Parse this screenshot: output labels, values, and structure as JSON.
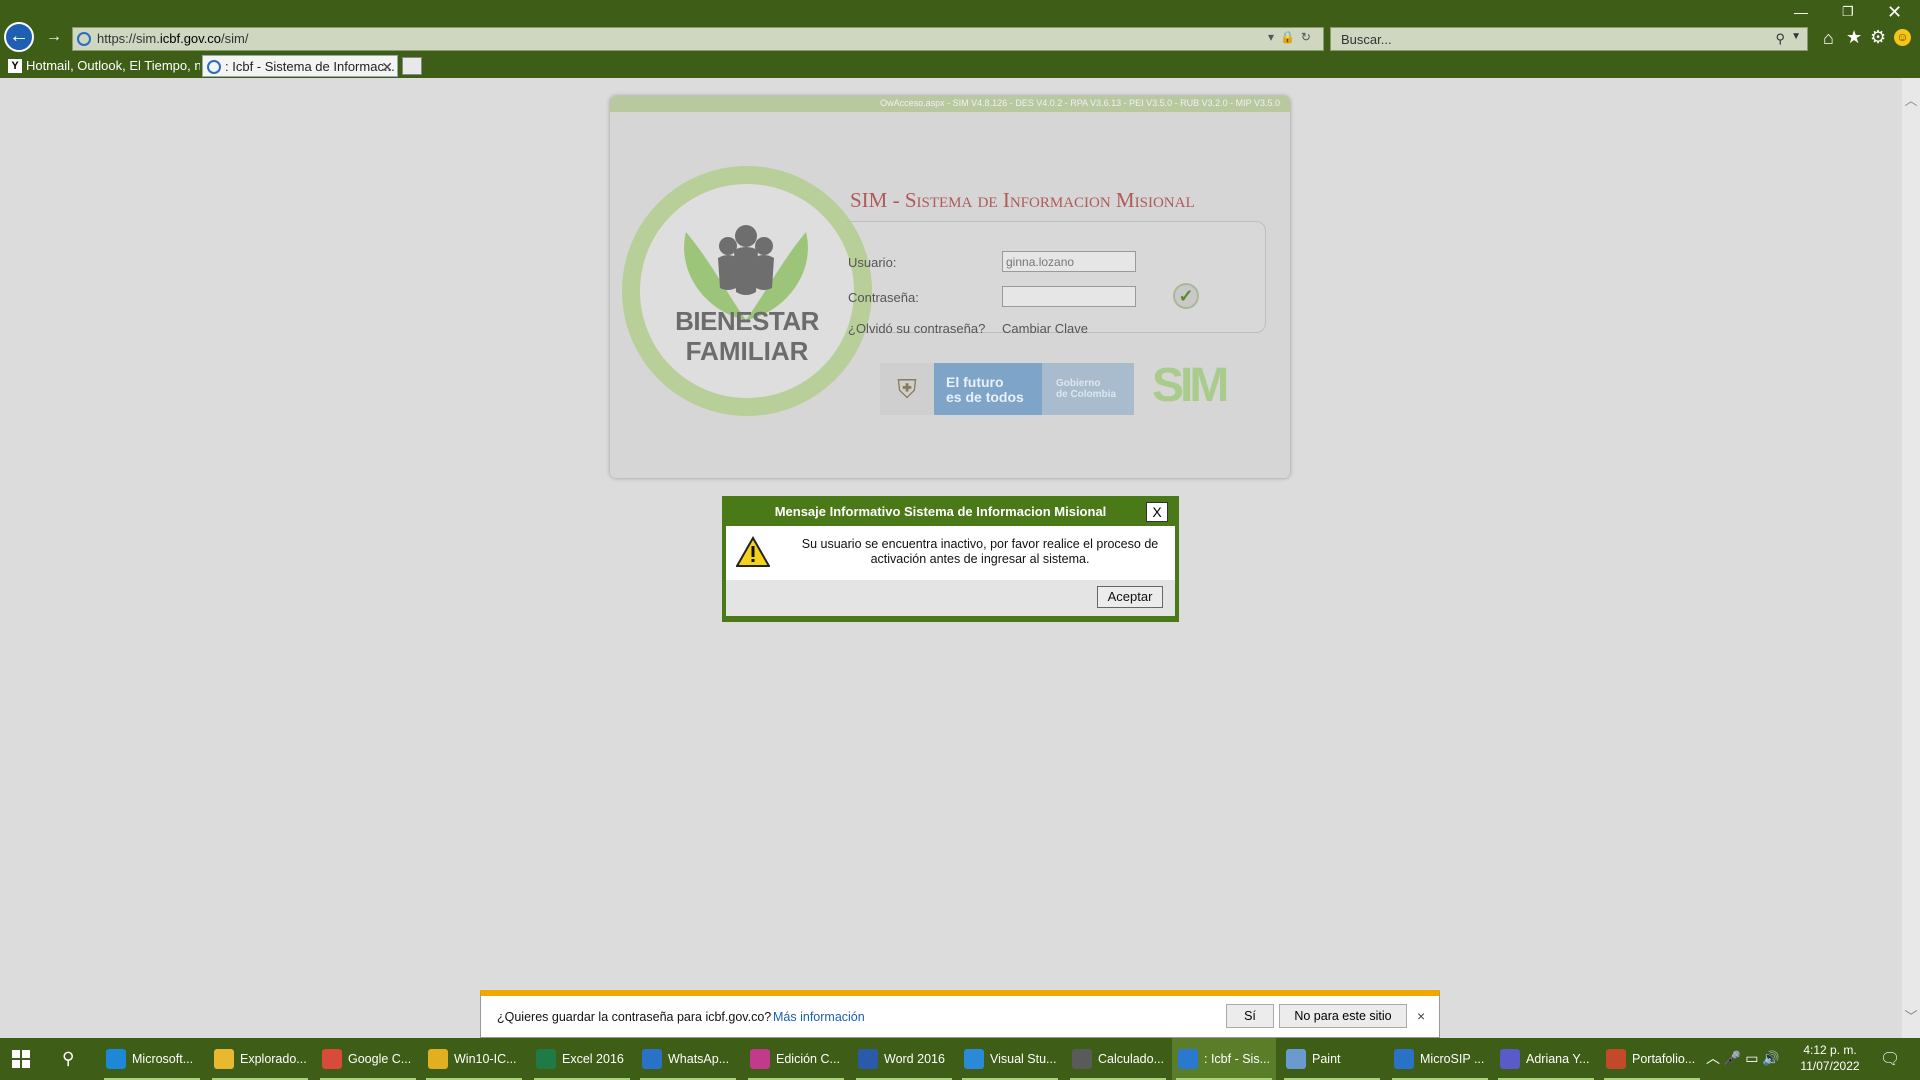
{
  "browser": {
    "url_prefix": "https://sim.",
    "url_domain": "icbf.gov.co",
    "url_path": "/sim/",
    "search_placeholder": "Buscar...",
    "tabs": [
      {
        "label": "Hotmail, Outlook, El Tiempo, n..."
      },
      {
        "label": ": Icbf - Sistema de Informac..."
      }
    ]
  },
  "login": {
    "version_text": "OwAcceso.aspx - SIM V4.8.126 - DES V4.0.2 - RPA V3.6.13 - PEI V3.5.0 - RUB V3.2.0 - MIP V3.5.0",
    "logo_line1": "BIENESTAR",
    "logo_line2": "FAMILIAR",
    "title": "SIM - Sistema de Informacion Misional",
    "user_label": "Usuario:",
    "user_value": "ginna.lozano",
    "password_label": "Contraseña:",
    "password_value": "",
    "forgot_label": "¿Olvidó su contraseña?",
    "change_label": "Cambiar Clave",
    "futuro_line1": "El futuro",
    "futuro_line2": "es de todos",
    "gobierno_line1": "Gobierno",
    "gobierno_line2": "de Colombia",
    "sim_logo": "SIM"
  },
  "dialog": {
    "title": "Mensaje Informativo Sistema de Informacion Misional",
    "close_label": "X",
    "message": "Su usuario se encuentra inactivo, por favor realice el proceso de activación antes de ingresar al sistema.",
    "ok_label": "Aceptar"
  },
  "password_bar": {
    "question": "¿Quieres guardar la contraseña para icbf.gov.co?",
    "more_info": "Más información",
    "yes_label": "Sí",
    "no_label": "No para este sitio",
    "close_label": "×"
  },
  "taskbar": {
    "items": [
      {
        "label": "Microsoft...",
        "icon": "edge-icon",
        "color": "#1e88d8"
      },
      {
        "label": "Explorado...",
        "icon": "folder-icon",
        "color": "#e8b830"
      },
      {
        "label": "Google C...",
        "icon": "chrome-icon",
        "color": "#d84a3a"
      },
      {
        "label": "Win10-IC...",
        "icon": "remote-icon",
        "color": "#e0b020"
      },
      {
        "label": "Excel 2016",
        "icon": "excel-icon",
        "color": "#1f7a45"
      },
      {
        "label": "WhatsAp...",
        "icon": "whatsapp-icon",
        "color": "#2a72c8"
      },
      {
        "label": "Edición C...",
        "icon": "edit-icon",
        "color": "#c23a8a"
      },
      {
        "label": "Word 2016",
        "icon": "word-icon",
        "color": "#2b5aa8"
      },
      {
        "label": "Visual Stu...",
        "icon": "vscode-icon",
        "color": "#2a8ad8"
      },
      {
        "label": "Calculado...",
        "icon": "calculator-icon",
        "color": "#5a5a5a"
      },
      {
        "label": ": Icbf - Sis...",
        "icon": "ie-icon",
        "color": "#2a78d0"
      },
      {
        "label": "Paint",
        "icon": "paint-icon",
        "color": "#6a9ad0"
      },
      {
        "label": "MicroSIP ...",
        "icon": "phone-icon",
        "color": "#2a72c8"
      },
      {
        "label": "Adriana Y...",
        "icon": "teams-icon",
        "color": "#5a5ac8"
      },
      {
        "label": "Portafolio...",
        "icon": "powerpoint-icon",
        "color": "#c24a2a"
      }
    ],
    "active_index": 10,
    "time": "4:12 p. m.",
    "date": "11/07/2022"
  },
  "colors": {
    "chrome": "#3e5d16",
    "dialog_frame": "#4a7a18",
    "accent_bar": "#f0a800"
  }
}
